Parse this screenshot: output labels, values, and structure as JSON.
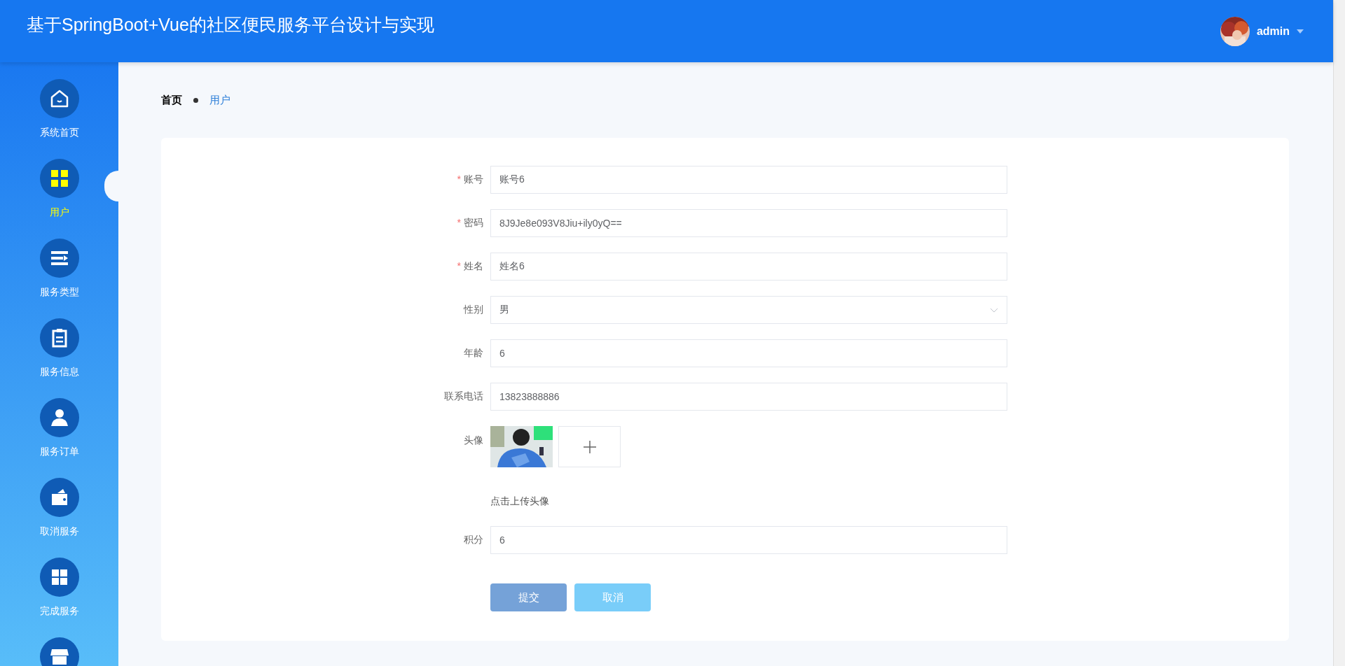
{
  "header": {
    "title": "基于SpringBoot+Vue的社区便民服务平台设计与实现",
    "user": {
      "name": "admin"
    }
  },
  "sidebar": {
    "items": [
      {
        "label": "系统首页",
        "selected": false
      },
      {
        "label": "用户",
        "selected": true
      },
      {
        "label": "服务类型",
        "selected": false
      },
      {
        "label": "服务信息",
        "selected": false
      },
      {
        "label": "服务订单",
        "selected": false
      },
      {
        "label": "取消服务",
        "selected": false
      },
      {
        "label": "完成服务",
        "selected": false
      },
      {
        "selected": false
      }
    ]
  },
  "breadcrumb": [
    "首页",
    "用户"
  ],
  "form": {
    "fields": [
      {
        "kind": "text",
        "required_mark": "*",
        "label": "账号",
        "value": "账号6"
      },
      {
        "kind": "text",
        "required_mark": "*",
        "label": "密码",
        "value": "8J9Je8e093V8Jiu+ily0yQ=="
      },
      {
        "kind": "text",
        "required_mark": "*",
        "label": "姓名",
        "value": "姓名6"
      },
      {
        "kind": "select",
        "label": "性别",
        "value": "男"
      },
      {
        "kind": "text",
        "label": "年龄",
        "value": "6"
      },
      {
        "kind": "text",
        "label": "联系电话",
        "value": "13823888886"
      },
      {
        "kind": "upload",
        "label": "头像",
        "hint": "点击上传头像"
      },
      {
        "kind": "text",
        "label": "积分",
        "value": "6"
      }
    ],
    "buttons": [
      {
        "label": "提交",
        "kind": "primary"
      },
      {
        "label": "取消",
        "kind": "cancel"
      }
    ]
  }
}
